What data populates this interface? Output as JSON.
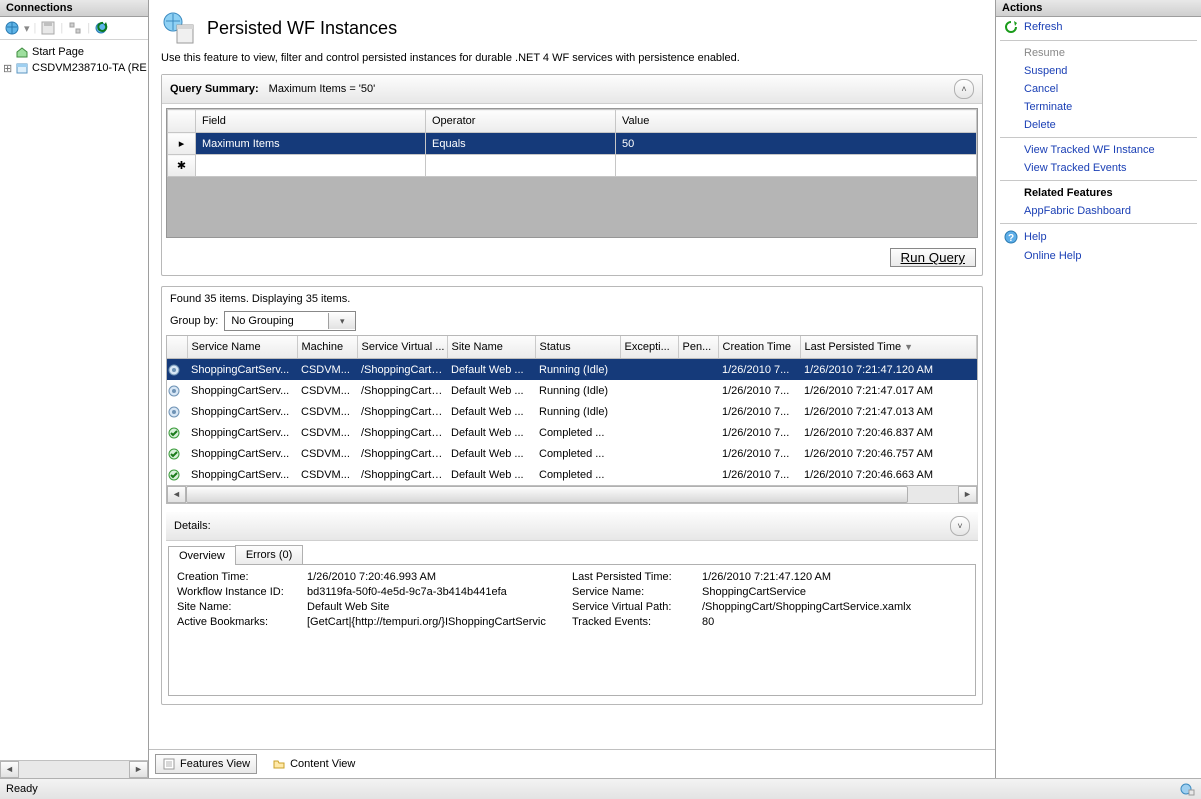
{
  "left": {
    "title": "Connections",
    "tree": {
      "start_page": "Start Page",
      "server": "CSDVM238710-TA (RE"
    }
  },
  "right": {
    "title": "Actions",
    "items": {
      "refresh": "Refresh",
      "resume": "Resume",
      "suspend": "Suspend",
      "cancel": "Cancel",
      "terminate": "Terminate",
      "delete": "Delete",
      "view_instance": "View Tracked WF Instance",
      "view_events": "View Tracked Events",
      "related": "Related Features",
      "dashboard": "AppFabric Dashboard",
      "help": "Help",
      "online_help": "Online Help"
    }
  },
  "main": {
    "title": "Persisted WF Instances",
    "desc": "Use this feature to view, filter and control persisted instances for durable .NET 4 WF services with persistence enabled.",
    "query": {
      "label": "Query Summary:",
      "summary": "Maximum Items = '50'",
      "cols": {
        "field": "Field",
        "operator": "Operator",
        "value": "Value"
      },
      "rows": [
        {
          "field": "Maximum Items",
          "operator": "Equals",
          "value": "50"
        }
      ],
      "run_label": "Run Query"
    },
    "found": "Found 35 items. Displaying 35 items.",
    "group_by_label": "Group by:",
    "group_by_value": "No Grouping",
    "list": {
      "cols": {
        "service": "Service Name",
        "machine": "Machine",
        "vpath": "Service Virtual ...",
        "site": "Site Name",
        "status": "Status",
        "excepti": "Excepti...",
        "pen": "Pen...",
        "ctime": "Creation Time",
        "ptime": "Last Persisted Time"
      },
      "rows": [
        {
          "icon": "gear",
          "service": "ShoppingCartServ...",
          "machine": "CSDVM...",
          "vpath": "/ShoppingCart/...",
          "site": "Default Web ...",
          "status": "Running (Idle)",
          "ex": "",
          "pen": "",
          "ctime": "1/26/2010 7...",
          "ptime": "1/26/2010 7:21:47.120 AM",
          "sel": true
        },
        {
          "icon": "gear",
          "service": "ShoppingCartServ...",
          "machine": "CSDVM...",
          "vpath": "/ShoppingCart/...",
          "site": "Default Web ...",
          "status": "Running (Idle)",
          "ex": "",
          "pen": "",
          "ctime": "1/26/2010 7...",
          "ptime": "1/26/2010 7:21:47.017 AM"
        },
        {
          "icon": "gear",
          "service": "ShoppingCartServ...",
          "machine": "CSDVM...",
          "vpath": "/ShoppingCart/...",
          "site": "Default Web ...",
          "status": "Running (Idle)",
          "ex": "",
          "pen": "",
          "ctime": "1/26/2010 7...",
          "ptime": "1/26/2010 7:21:47.013 AM"
        },
        {
          "icon": "check",
          "service": "ShoppingCartServ...",
          "machine": "CSDVM...",
          "vpath": "/ShoppingCart/...",
          "site": "Default Web ...",
          "status": "Completed ...",
          "ex": "",
          "pen": "",
          "ctime": "1/26/2010 7...",
          "ptime": "1/26/2010 7:20:46.837 AM"
        },
        {
          "icon": "check",
          "service": "ShoppingCartServ...",
          "machine": "CSDVM...",
          "vpath": "/ShoppingCart/...",
          "site": "Default Web ...",
          "status": "Completed ...",
          "ex": "",
          "pen": "",
          "ctime": "1/26/2010 7...",
          "ptime": "1/26/2010 7:20:46.757 AM"
        },
        {
          "icon": "check",
          "service": "ShoppingCartServ...",
          "machine": "CSDVM...",
          "vpath": "/ShoppingCart/...",
          "site": "Default Web ...",
          "status": "Completed ...",
          "ex": "",
          "pen": "",
          "ctime": "1/26/2010 7...",
          "ptime": "1/26/2010 7:20:46.663 AM"
        }
      ]
    },
    "details": {
      "label": "Details:",
      "tabs": {
        "overview": "Overview",
        "errors": "Errors (0)"
      },
      "overview": {
        "creation_time_l": "Creation Time:",
        "creation_time_v": "1/26/2010 7:20:46.993 AM",
        "instance_id_l": "Workflow Instance ID:",
        "instance_id_v": "bd3119fa-50f0-4e5d-9c7a-3b414b441efa",
        "site_l": "Site Name:",
        "site_v": "Default Web Site",
        "bookmarks_l": "Active Bookmarks:",
        "bookmarks_v": "[GetCart|{http://tempuri.org/}IShoppingCartServic",
        "last_persist_l": "Last Persisted Time:",
        "last_persist_v": "1/26/2010 7:21:47.120 AM",
        "svc_name_l": "Service Name:",
        "svc_name_v": "ShoppingCartService",
        "svc_vpath_l": "Service Virtual Path:",
        "svc_vpath_v": "/ShoppingCart/ShoppingCartService.xamlx",
        "tracked_l": "Tracked Events:",
        "tracked_v": "80"
      }
    },
    "views": {
      "features": "Features View",
      "content": "Content View"
    }
  },
  "status": {
    "ready": "Ready"
  }
}
